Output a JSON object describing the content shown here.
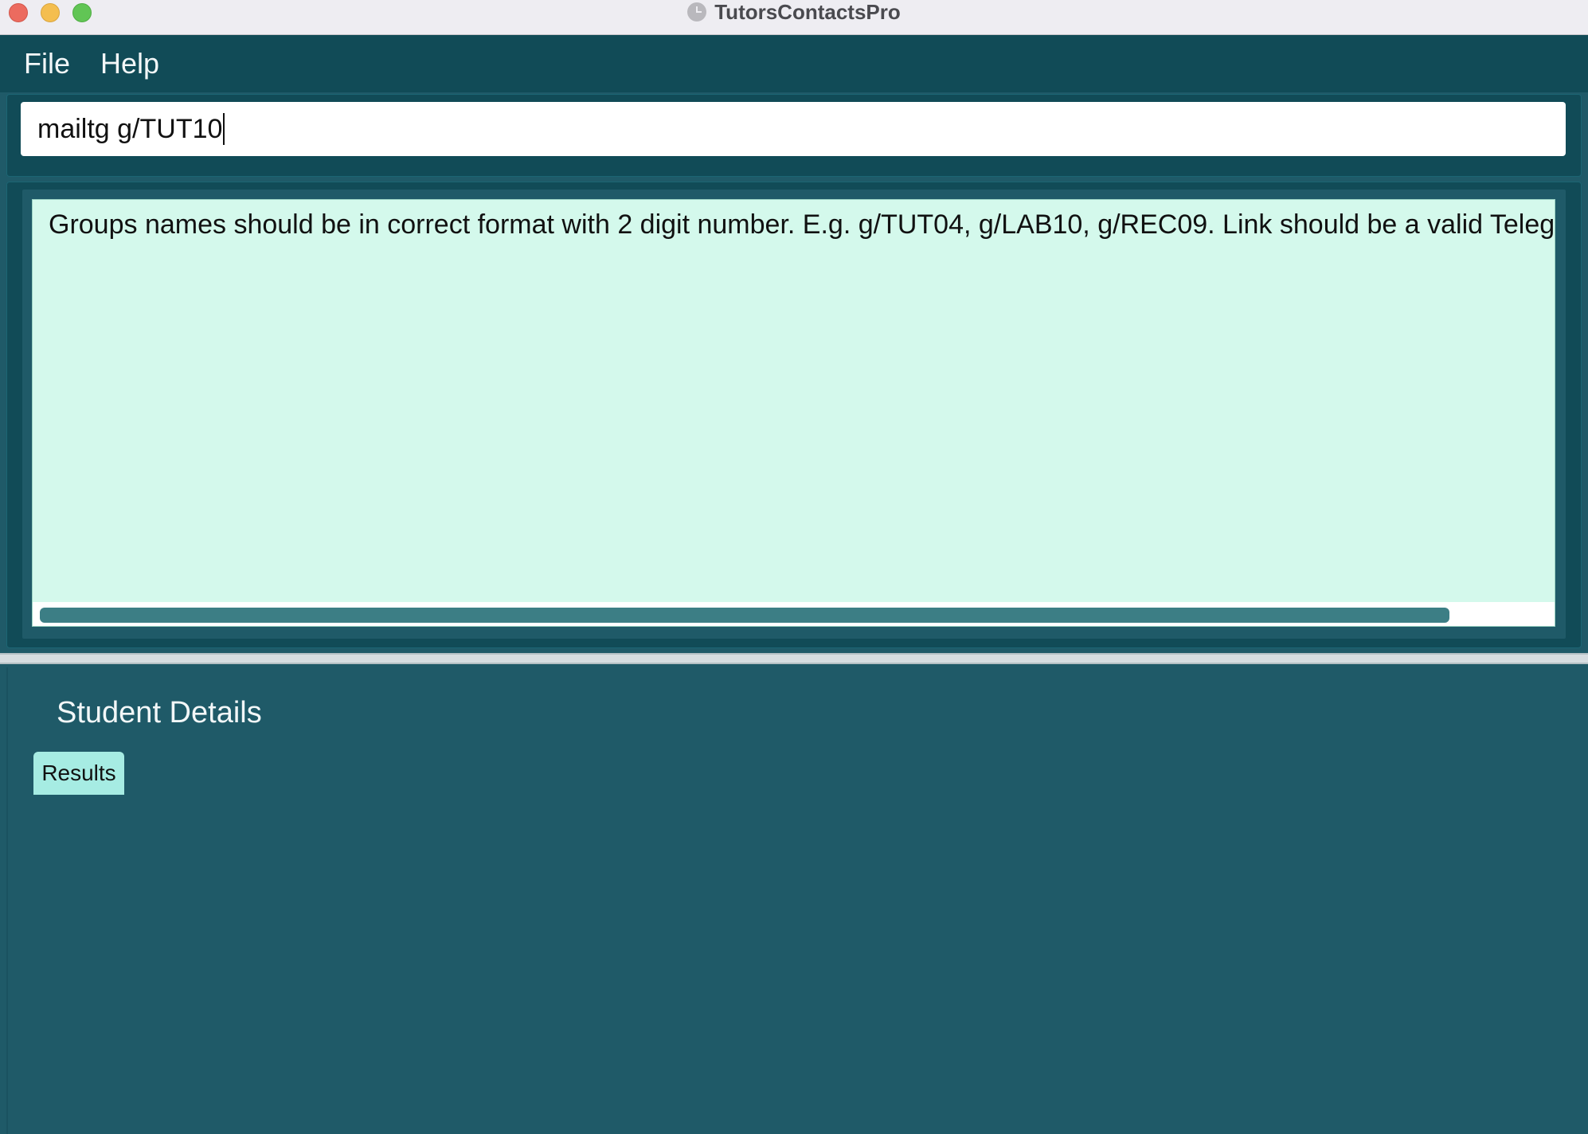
{
  "window": {
    "title": "TutorsContactsPro",
    "app_icon": "clock-icon"
  },
  "menu": {
    "items": [
      {
        "label": "File"
      },
      {
        "label": "Help"
      }
    ]
  },
  "command": {
    "value": "mailtg g/TUT10"
  },
  "result": {
    "message": "Groups names should be in correct format with 2 digit number. E.g. g/TUT04, g/LAB10, g/REC09. Link should be a valid Telegram in"
  },
  "details": {
    "title": "Student Details",
    "tabs": [
      {
        "label": "Results",
        "selected": true
      }
    ]
  },
  "colors": {
    "background": "#1f5a68",
    "menubar": "#114b57",
    "result_box": "#d4f9ec",
    "tab_selected": "#a6ece3",
    "scroll_thumb": "#3c7e85"
  }
}
